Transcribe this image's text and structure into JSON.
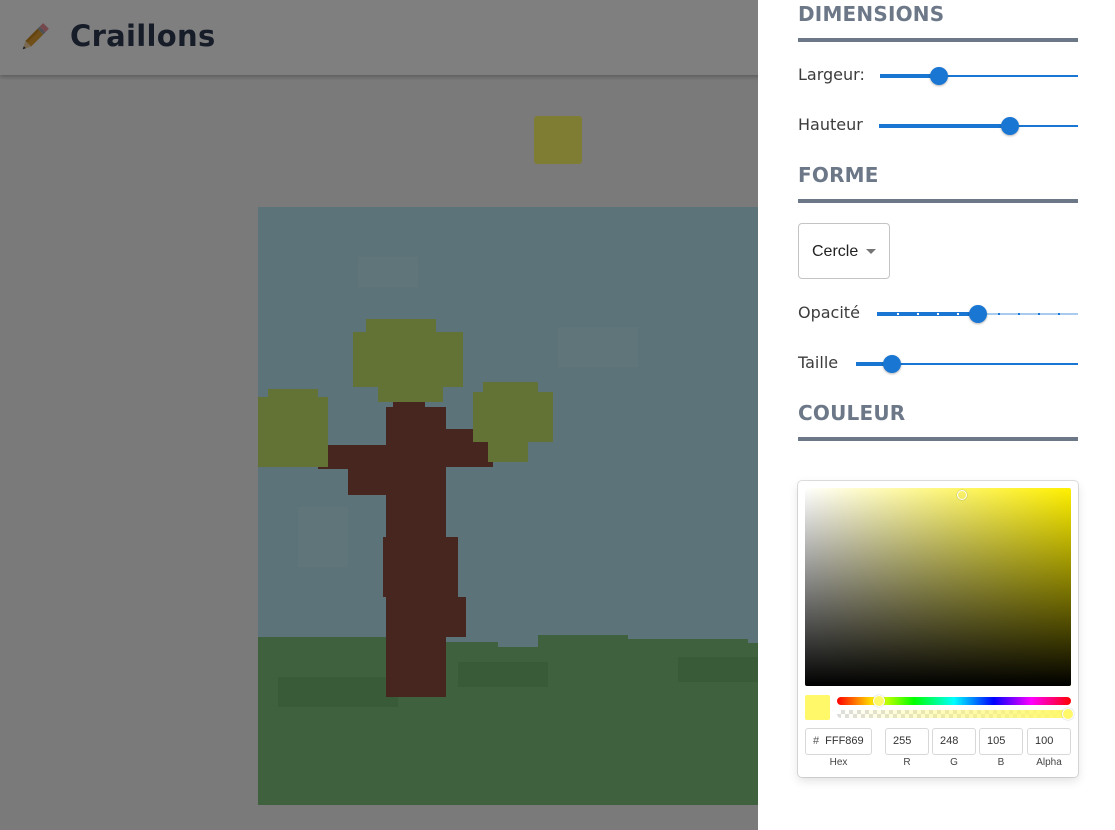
{
  "app": {
    "title": "Craillons"
  },
  "drawing": {
    "preview_color": "#fff869",
    "sun_color": "#f0e050"
  },
  "drawer": {
    "dimensions": {
      "title": "DIMENSIONS",
      "width_label": "Largeur:",
      "width_value": 0.3,
      "height_label": "Hauteur",
      "height_value": 0.66
    },
    "shape": {
      "title": "FORME",
      "select_value": "Cercle",
      "opacity_label": "Opacité",
      "opacity_value": 0.5,
      "size_label": "Taille",
      "size_value": 0.16
    },
    "color": {
      "title": "COULEUR",
      "picker": {
        "current_color": "#fff869",
        "hex": "FFF869",
        "hex_prefix": "#",
        "r": "255",
        "g": "248",
        "b": "105",
        "alpha": "100",
        "labels": {
          "hex": "Hex",
          "r": "R",
          "g": "G",
          "b": "B",
          "alpha": "Alpha"
        }
      }
    }
  },
  "colors": {
    "accent": "#1976d2",
    "section": "#6c7788",
    "title": "#2d3a52"
  }
}
